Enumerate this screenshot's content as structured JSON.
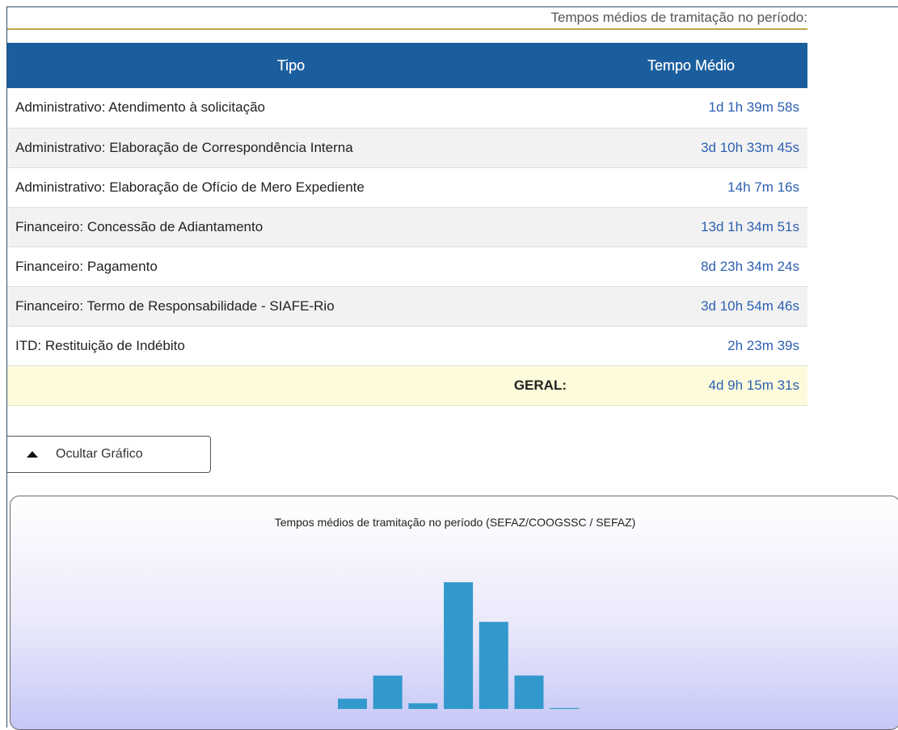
{
  "header": {
    "caption": "Tempos médios de tramitação no período:"
  },
  "table": {
    "columns": [
      "Tipo",
      "Tempo Médio"
    ],
    "rows": [
      {
        "tipo": "Administrativo: Atendimento à solicitação",
        "tempo": "1d 1h 39m 58s"
      },
      {
        "tipo": "Administrativo: Elaboração de Correspondência Interna",
        "tempo": "3d 10h 33m 45s"
      },
      {
        "tipo": "Administrativo: Elaboração de Ofício de Mero Expediente",
        "tempo": "14h 7m 16s"
      },
      {
        "tipo": "Financeiro: Concessão de Adiantamento",
        "tempo": "13d 1h 34m 51s"
      },
      {
        "tipo": "Financeiro: Pagamento",
        "tempo": "8d 23h 34m 24s"
      },
      {
        "tipo": "Financeiro: Termo de Responsabilidade - SIAFE-Rio",
        "tempo": "3d 10h 54m 46s"
      },
      {
        "tipo": "ITD: Restituição de Indébito",
        "tempo": "2h 23m 39s"
      }
    ],
    "total": {
      "label": "GERAL:",
      "tempo": "4d 9h 15m 31s"
    }
  },
  "toggle": {
    "label": "Ocultar Gráfico",
    "icon": "triangle-up-icon"
  },
  "colors": {
    "header_bg": "#1b5e9e",
    "time_text": "#2d5fb0",
    "bar": "#3399cc",
    "total_row_bg": "#fdfbdb"
  },
  "chart_data": {
    "type": "bar",
    "title": "Tempos médios de tramitação no período (SEFAZ/COOGSSC / SEFAZ)",
    "xlabel": "",
    "ylabel": "",
    "categories": [
      "Administrativo: Atendimento à solicitação",
      "Administrativo: Elaboração de Correspondência Interna",
      "Administrativo: Elaboração de Ofício de Mero Expediente",
      "Financeiro: Concessão de Adiantamento",
      "Financeiro: Pagamento",
      "Financeiro: Termo de Responsabilidade - SIAFE-Rio",
      "ITD: Restituição de Indébito"
    ],
    "values": [
      1.07,
      3.44,
      0.59,
      13.07,
      8.98,
      3.45,
      0.1
    ],
    "value_unit": "days",
    "ylim": [
      0,
      14
    ],
    "grid": false
  }
}
